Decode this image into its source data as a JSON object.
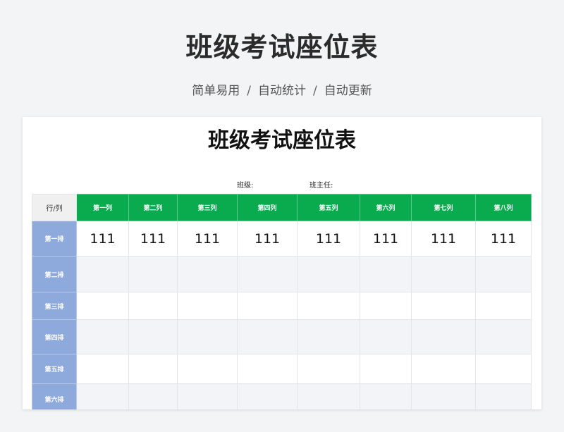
{
  "page": {
    "title": "班级考试座位表",
    "subtitle": [
      "简单易用",
      "自动统计",
      "自动更新"
    ],
    "separator": "/"
  },
  "sheet": {
    "title": "班级考试座位表",
    "class_label": "班级:",
    "teacher_label": "班主任:",
    "corner_label": "行/列",
    "columns": [
      "第一列",
      "第二列",
      "第三列",
      "第四列",
      "第五列",
      "第六列",
      "第七列",
      "第八列"
    ],
    "rows": [
      {
        "label": "第一排",
        "cells": [
          "111",
          "111",
          "111",
          "111",
          "111",
          "111",
          "111",
          "111"
        ]
      },
      {
        "label": "第二排",
        "cells": [
          "",
          "",
          "",
          "",
          "",
          "",
          "",
          ""
        ]
      },
      {
        "label": "第三排",
        "cells": [
          "",
          "",
          "",
          "",
          "",
          "",
          "",
          ""
        ]
      },
      {
        "label": "第四排",
        "cells": [
          "",
          "",
          "",
          "",
          "",
          "",
          "",
          ""
        ]
      },
      {
        "label": "第五排",
        "cells": [
          "",
          "",
          "",
          "",
          "",
          "",
          "",
          ""
        ]
      },
      {
        "label": "第六排",
        "cells": [
          "",
          "",
          "",
          "",
          "",
          "",
          "",
          ""
        ]
      }
    ],
    "colors": {
      "header_green": "#0aab4e",
      "row_header_blue": "#8ea9db"
    }
  }
}
